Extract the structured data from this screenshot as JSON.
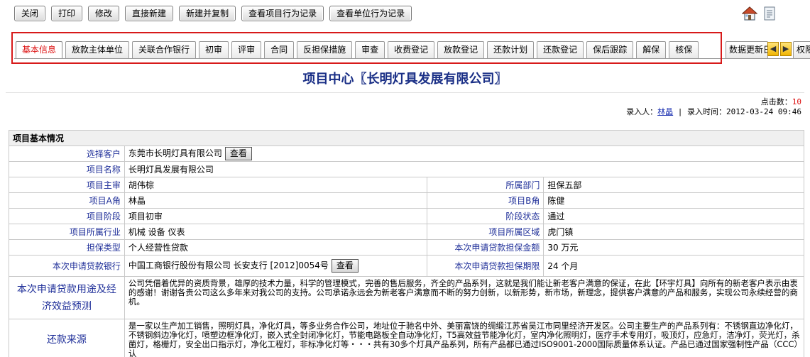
{
  "toolbar": {
    "close": "关闭",
    "print": "打印",
    "edit": "修改",
    "create": "直接新建",
    "copy": "新建并复制",
    "project_log": "查看项目行为记录",
    "unit_log": "查看单位行为记录"
  },
  "tabs": [
    "基本信息",
    "放款主体单位",
    "关联合作银行",
    "初审",
    "评审",
    "合同",
    "反担保措施",
    "审查",
    "收费登记",
    "放款登记",
    "还款计划",
    "还款登记",
    "保后跟踪",
    "解保",
    "核保"
  ],
  "tabs_extra": [
    "数据更新日",
    "权限"
  ],
  "title": "项目中心〖长明灯具发展有限公司〗",
  "meta": {
    "clicks_label": "点击数：",
    "clicks_value": "10",
    "entry_prefix": "录入人：",
    "entry_user": "林晶",
    "entry_time": " | 录入时间：2012-03-24 09:46"
  },
  "section_title": "项目基本情况",
  "view_button": "查看",
  "rows": {
    "customer_label": "选择客户",
    "customer_value": "东莞市长明灯具有限公司",
    "name_label": "项目名称",
    "name_value": "长明灯具发展有限公司",
    "lead_label": "项目主审",
    "lead_value": "胡伟棕",
    "dept_label": "所属部门",
    "dept_value": "担保五部",
    "a_label": "项目A角",
    "a_value": "林晶",
    "b_label": "项目B角",
    "b_value": "陈健",
    "stage_label": "项目阶段",
    "stage_value": "项目初审",
    "status_label": "阶段状态",
    "status_value": "通过",
    "industry_label": "项目所属行业",
    "industry_value": "机械 设备 仪表",
    "region_label": "项目所属区域",
    "region_value": "虎门镇",
    "type_label": "担保类型",
    "type_value": "个人经营性贷款",
    "amount_label": "本次申请贷款担保金额",
    "amount_value": "30 万元",
    "bank_label": "本次申请贷款银行",
    "bank_value": "中国工商银行股份有限公司 长安支行 [2012]0054号",
    "period_label": "本次申请贷款担保期限",
    "period_value": "24 个月",
    "purpose_label": "本次申请贷款用途及经济效益预测",
    "purpose_value": "公司凭借着优异的资质背景，雄厚的技术力量，科学的管理模式，完善的售后服务，齐全的产品系列，这就是我们能让新老客户满意的保证，在此【环宇灯具】向所有的新老客户表示由衷的感谢！谢谢各贵公司这么多年来对我公司的支持。公司承诺永远会为新老客户满意而不断的努力创新，以新形势，新市场，新理念，提供客户满意的产品和服务，实现公司永续经营的商机。",
    "source_label": "还款来源",
    "source_value": "是一家以生产加工销售，照明灯具，净化灯具，等多业务合作公司，地址位于驰名中外、美丽富饶的绸缎江苏省吴江市同里经济开发区。公司主要生产的产品系列有：不锈钢直边净化灯，不锈钢斜边净化灯，喷塑边框净化灯，嵌入式全封闭净化灯，节能电路板全自动净化灯，T5高效益节能净化灯，室内净化照明灯，医疗手术专用灯，吸顶灯，应急灯，洁净灯，荧光灯，杀菌灯，格栅灯，安全出口指示灯，净化工程灯，非标净化灯等・・・共有30多个灯具产品系列，所有产品都已通过ISO9001-2000国际质量体系认证。产品已通过国家强制性产品（CCC）认"
  }
}
